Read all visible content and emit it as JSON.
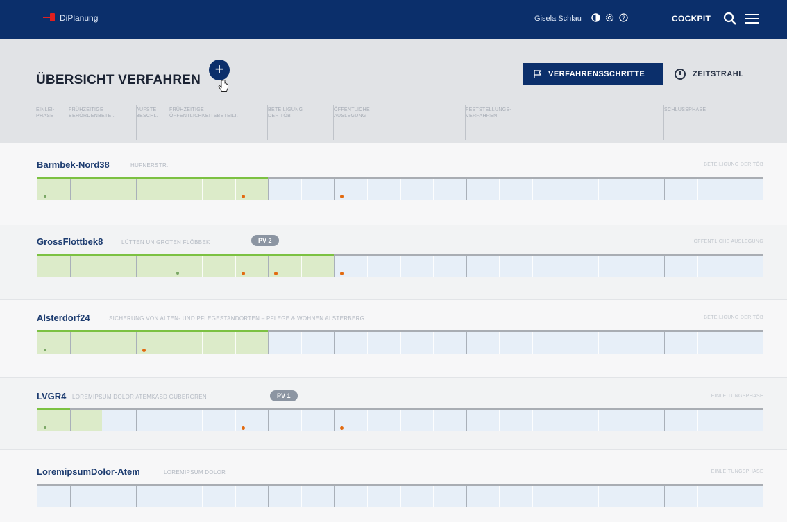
{
  "topbar": {
    "app_name": "DiPlanung",
    "user_name": "Gisela Schlau",
    "cockpit_label": "COCKPIT"
  },
  "header": {
    "title": "ÜBERSICHT VERFAHREN",
    "add_label": "+",
    "steps_button": "VERFAHRENSSCHRITTE",
    "timeline_button": "ZEITSTRAHL",
    "phases": [
      "EINLEI-\nPHASE",
      "FRÜHZEITIGE\nBEHÖRDENBETEI.",
      "AUFSTE\nBESCHL.",
      "FRÜHZEITIGE\nÖFFENTLICHKEITSBETEILI.",
      "BETEILIGUNG\nDER TÖB",
      "ÖFFENTLICHE\nAUSLEGUNG",
      "FESTSTELLUNGS-\nVERFAHREN",
      "SCHLUSSPHASE"
    ]
  },
  "colors": {
    "brand_navy": "#0b2f6b",
    "progress_green": "#7cc142",
    "milestone_orange": "#e26a10",
    "done_fill": "#dcebc9",
    "open_fill": "#e7eff8"
  },
  "procedures": [
    {
      "name": "Barmbek-Nord38",
      "subtitle": "HUFNERSTR.",
      "badge": "",
      "current_phase": "BETEILIGUNG DER TÖB",
      "progress_cells": 7
    },
    {
      "name": "GrossFlottbek8",
      "subtitle": "LÜTTEN UN GROTEN FLÖBBEK",
      "badge": "PV 2",
      "current_phase": "ÖFFENTLICHE AUSLEGUNG",
      "progress_cells": 9
    },
    {
      "name": "Alsterdorf24",
      "subtitle": "SICHERUNG VON ALTEN- UND PFLEGESTANDORTEN – PFLEGE & WOHNEN ALSTERBERG",
      "badge": "",
      "current_phase": "BETEILIGUNG DER TÖB",
      "progress_cells": 7
    },
    {
      "name": "LVGR4",
      "subtitle": "LOREMIPSUM DOLOR ATEMKASD GUBERGREN",
      "badge": "PV 1",
      "current_phase": "EINLEITUNGSPHASE",
      "progress_cells": 1
    },
    {
      "name": "LoremipsumDolor-Atem",
      "subtitle": "LOREMIPSUM DOLOR",
      "badge": "",
      "current_phase": "EINLEITUNGSPHASE",
      "progress_cells": 0
    }
  ]
}
